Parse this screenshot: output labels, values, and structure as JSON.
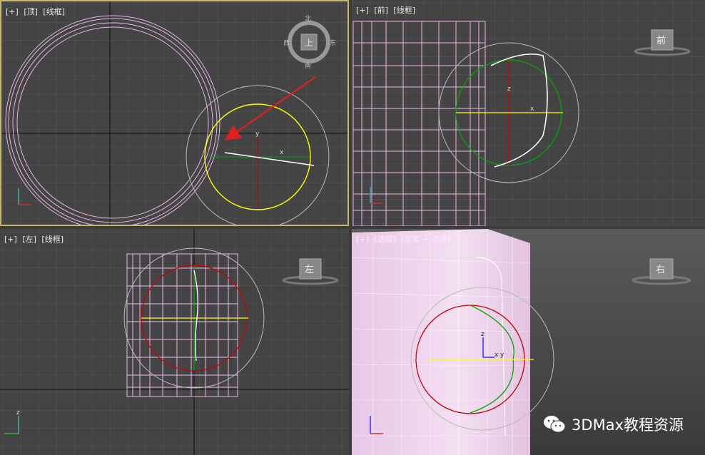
{
  "viewports": {
    "top": {
      "plus": "[+]",
      "view": "[顶]",
      "mode": "[线框]"
    },
    "front": {
      "plus": "[+]",
      "view": "[前]",
      "mode": "[线框]"
    },
    "left": {
      "plus": "[+]",
      "view": "[左]",
      "mode": "[线框]"
    },
    "perspective": {
      "plus": "[+]",
      "view": "[透视]",
      "mode": "[真实 + 边面]"
    }
  },
  "viewcube": {
    "top_face": "上",
    "north": "北",
    "south": "南",
    "east": "东",
    "west": "西",
    "front_face": "前",
    "left_face": "左",
    "right_face": "右"
  },
  "axes": {
    "x": "x",
    "y": "y",
    "z": "z"
  },
  "watermark": {
    "text": "3DMax教程资源",
    "icon": "wechat-icon"
  },
  "colors": {
    "viewport_bg": "#444444",
    "grid": "#555555",
    "wire": "#e8b6e6",
    "active_border": "#c9b96a",
    "gizmo_yellow": "#ffff00",
    "gizmo_red": "#cc0000",
    "gizmo_green": "#00aa00",
    "arrow_red": "#e02020"
  }
}
